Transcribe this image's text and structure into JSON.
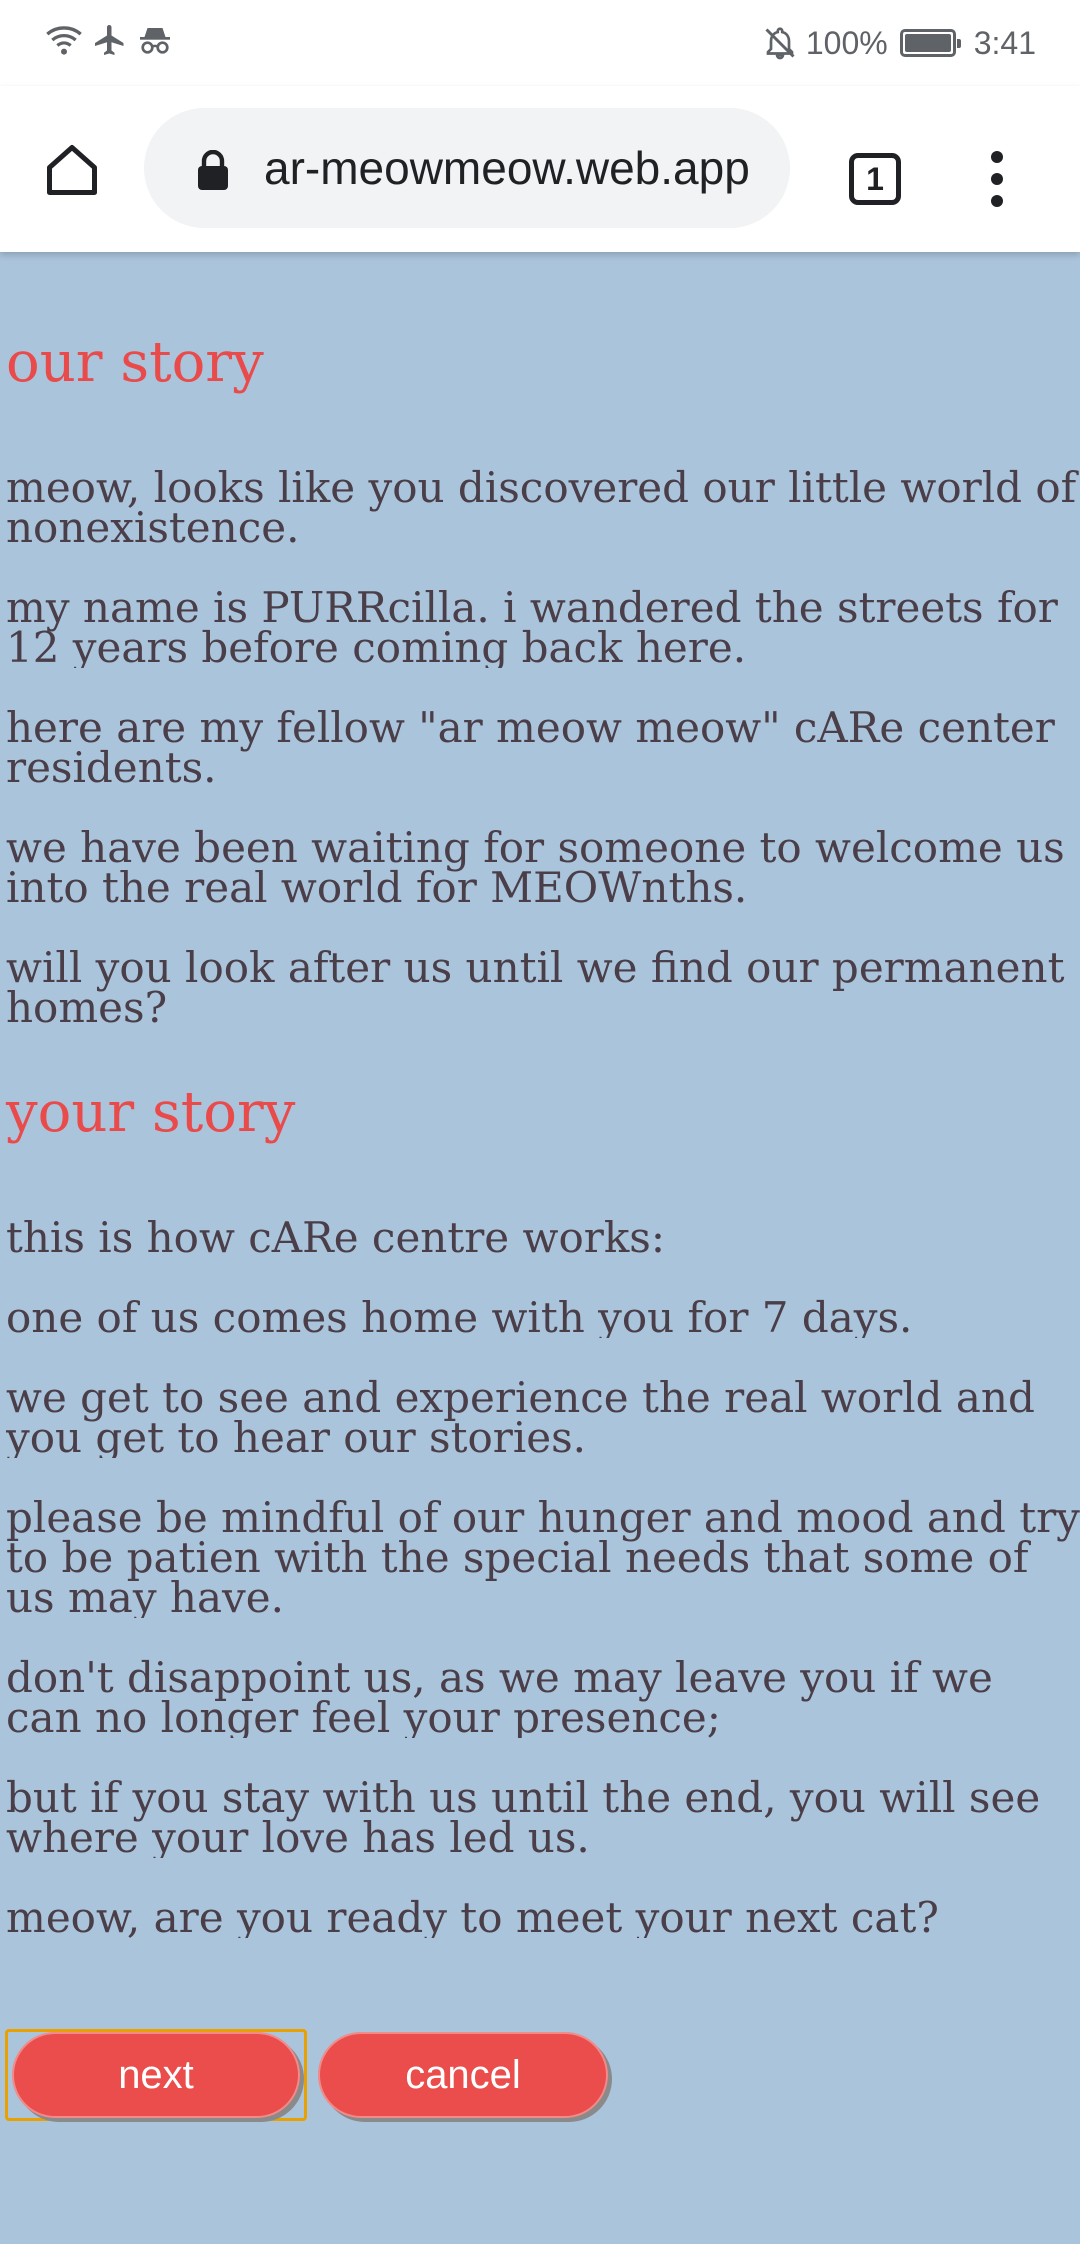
{
  "status_bar": {
    "battery_percent": "100%",
    "battery_level": 1.0,
    "time": "3:41",
    "icons": [
      "wifi-icon",
      "airplane-icon",
      "incognito-icon",
      "mute-icon",
      "battery-icon"
    ]
  },
  "browser": {
    "url": "ar-meowmeow.web.app",
    "tab_count": "1",
    "icons": [
      "home-icon",
      "lock-icon",
      "tab-switcher-icon",
      "more-options-icon"
    ]
  },
  "page": {
    "our_story": {
      "heading": "our story",
      "paragraphs": [
        "meow, looks like you discovered our little world of nonexistence.",
        "my name is PURRcilla. i wandered the streets for 12 years before coming back here.",
        "here are my fellow \"ar meow meow\" cARe center residents.",
        "we have been waiting for someone to welcome us into the real world for MEOWnths.",
        "will you look after us until we find our permanent homes?"
      ]
    },
    "your_story": {
      "heading": "your story",
      "paragraphs": [
        "this is how cARe centre works:",
        "one of us comes home with you for 7 days.",
        "we get to see and experience the real world and you get to hear our stories.",
        "please be mindful of our hunger and mood and try to be patien with the special needs that some of us may have.",
        "don't disappoint us, as we may leave you if we can no longer feel your presence;",
        "but if you stay with us until the end, you will see where your love has led us.",
        "meow, are you ready to meet your next cat?"
      ]
    },
    "buttons": {
      "next": "next",
      "cancel": "cancel"
    }
  },
  "colors": {
    "page_background": "#aac4dc",
    "heading": "#e94b4b",
    "body_text": "#4a3e48",
    "button": "#ea4d4b",
    "focus_outline": "#e8a100"
  }
}
